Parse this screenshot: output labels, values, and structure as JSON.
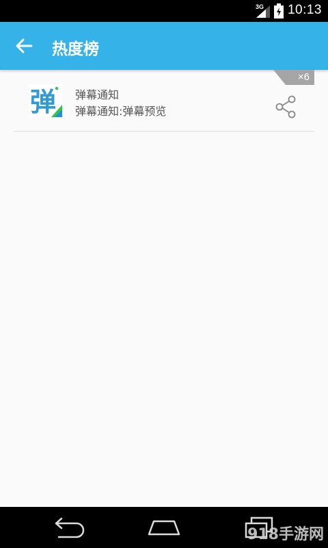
{
  "status_bar": {
    "network": "3G",
    "time": "10:13"
  },
  "app_bar": {
    "title": "热度榜"
  },
  "items": [
    {
      "icon_glyph": "弹",
      "title": "弹幕通知",
      "subtitle": "弹幕通知:弹幕预览",
      "badge": "×6"
    }
  ],
  "watermark": "918手游网",
  "colors": {
    "accent": "#35b3e8",
    "background": "#fafafa",
    "badge": "#a5a5a5"
  }
}
